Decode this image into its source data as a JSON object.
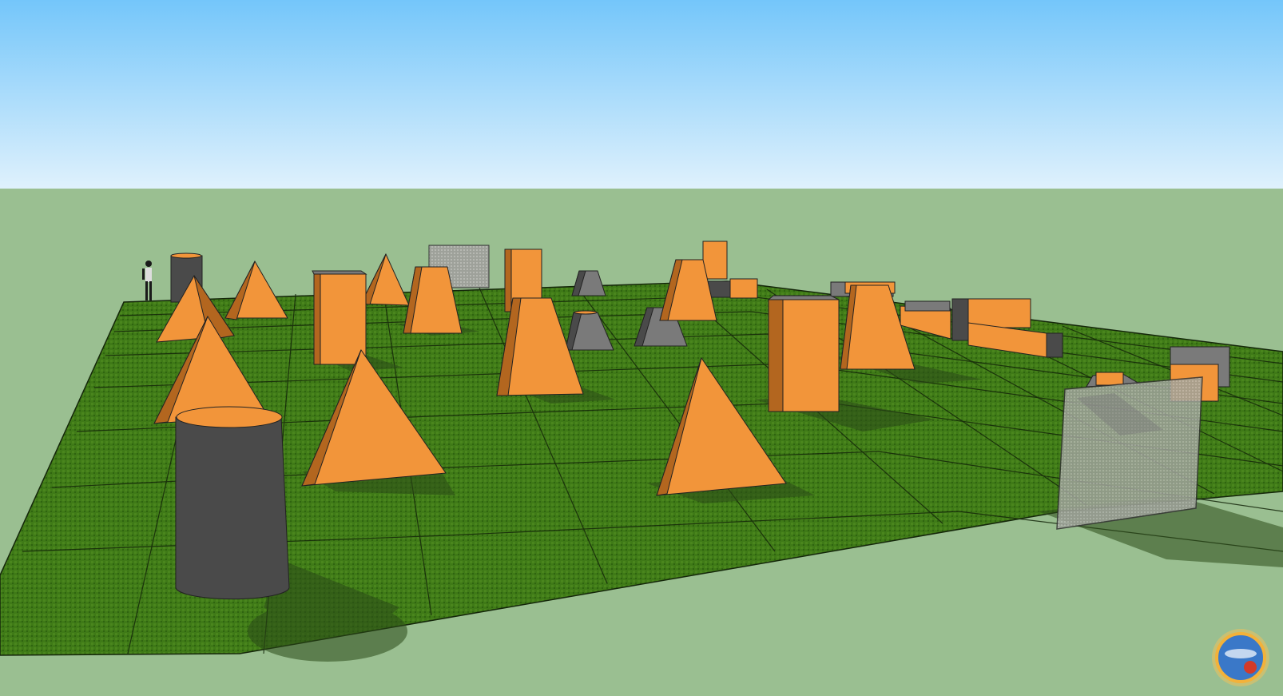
{
  "scene": {
    "colors": {
      "sky_top": "#74c6fa",
      "sky_bottom": "#dff1fc",
      "ground": "#9abf91",
      "field": "#3f7a17",
      "field_light": "#558d22",
      "grid_line": "#14260a",
      "orange": "#f2953a",
      "orange_dark": "#b3661f",
      "gray": "#7a7a7a",
      "gray_dark": "#4a4a4a",
      "shadow": "#2b4a18",
      "net": "#9ea19a"
    },
    "icons": [
      "person-figure",
      "logo-badge"
    ]
  }
}
